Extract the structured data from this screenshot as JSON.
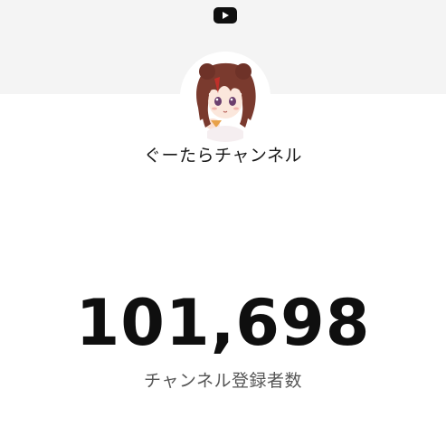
{
  "header": {
    "logo_icon": "youtube-logo-icon"
  },
  "channel": {
    "name": "ぐーたらチャンネル",
    "avatar_icon": "channel-avatar-anime-girl"
  },
  "stats": {
    "subscriber_count": "101,698",
    "subscriber_label": "チャンネル登録者数"
  },
  "colors": {
    "banner": "#f4f4f4",
    "background": "#ffffff",
    "count_text": "#0f0f0f",
    "label_text": "#555555",
    "logo": "#0f0f0f"
  }
}
